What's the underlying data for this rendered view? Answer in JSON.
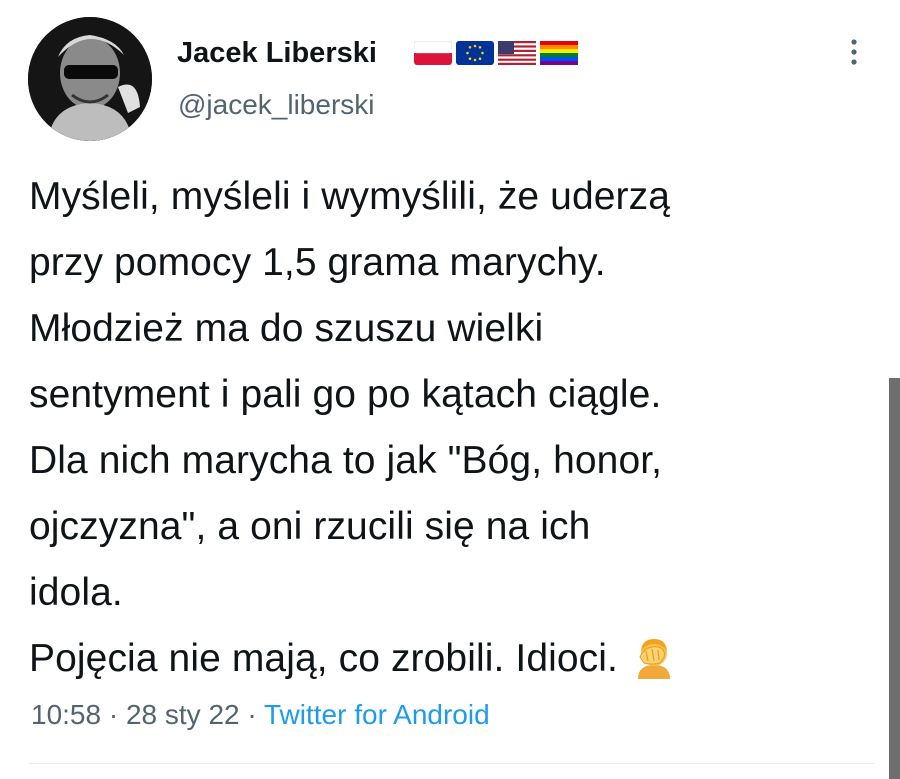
{
  "author": {
    "display_name": "Jacek Liberski",
    "handle": "@jacek_liberski",
    "flags": [
      "flag-poland",
      "flag-eu",
      "flag-usa",
      "flag-rainbow"
    ]
  },
  "tweet": {
    "lines": [
      "Myśleli, myśleli i wymyślili, że uderzą",
      "przy pomocy 1,5 grama marychy.",
      "Młodzież ma do szuszu wielki",
      "sentyment i pali go po kątach ciągle.",
      "Dla nich marycha to jak \"Bóg, honor,",
      "ojczyzna\", a oni rzucili się na ich",
      "idola.",
      "Pojęcia nie mają, co zrobili. Idioci."
    ],
    "emoji": "facepalm-icon"
  },
  "meta": {
    "time": "10:58",
    "separator1": " · ",
    "date": "28 sty 22",
    "separator2": " · ",
    "source": "Twitter for Android"
  },
  "colors": {
    "text": "#0f1419",
    "secondary": "#536471",
    "link": "#1d9bf0"
  }
}
